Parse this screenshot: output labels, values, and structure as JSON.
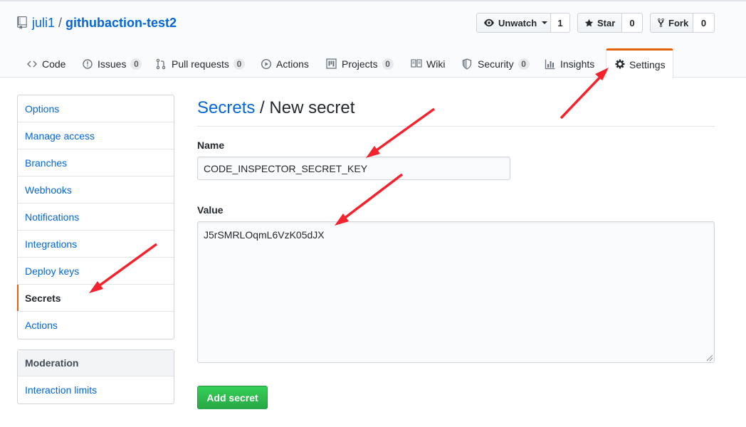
{
  "repo": {
    "owner": "juli1",
    "separator": "/",
    "name": "githubaction-test2"
  },
  "header_actions": [
    {
      "label": "Unwatch",
      "count": "1"
    },
    {
      "label": "Star",
      "count": "0"
    },
    {
      "label": "Fork",
      "count": "0"
    }
  ],
  "tabs": {
    "code": {
      "label": "Code"
    },
    "issues": {
      "label": "Issues",
      "count": "0"
    },
    "pull_requests": {
      "label": "Pull requests",
      "count": "0"
    },
    "actions": {
      "label": "Actions"
    },
    "projects": {
      "label": "Projects",
      "count": "0"
    },
    "wiki": {
      "label": "Wiki"
    },
    "security": {
      "label": "Security",
      "count": "0"
    },
    "insights": {
      "label": "Insights"
    },
    "settings": {
      "label": "Settings"
    }
  },
  "sidebar": {
    "items": [
      "Options",
      "Manage access",
      "Branches",
      "Webhooks",
      "Notifications",
      "Integrations",
      "Deploy keys",
      "Secrets",
      "Actions"
    ],
    "selected": "Secrets",
    "moderation_heading": "Moderation",
    "moderation_items": [
      "Interaction limits"
    ]
  },
  "page": {
    "breadcrumb": "Secrets",
    "separator": " / ",
    "title": "New secret",
    "name_label": "Name",
    "name_value": "CODE_INSPECTOR_SECRET_KEY",
    "value_label": "Value",
    "value_value": "J5rSMRLOqmL6VzK05dJX",
    "submit_label": "Add secret"
  },
  "colors": {
    "link": "#0366d6",
    "selected_tab_accent": "#e36209",
    "primary_button": "#28a745",
    "annotation_arrow": "#f5222d"
  }
}
